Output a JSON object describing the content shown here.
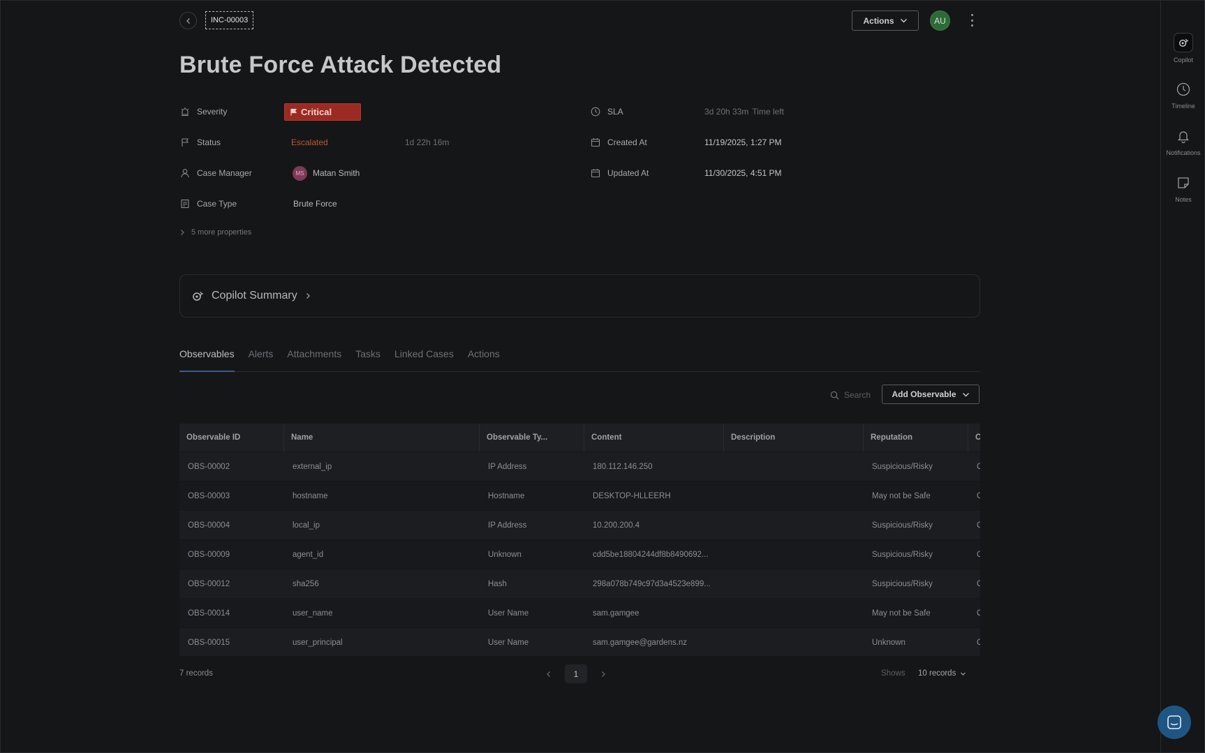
{
  "header": {
    "case_id": "INC-00003",
    "actions_label": "Actions",
    "user_initials": "AU"
  },
  "title": "Brute Force Attack Detected",
  "properties": {
    "severity_label": "Severity",
    "severity_value": "Critical",
    "status_label": "Status",
    "status_value": "Escalated",
    "status_duration": "1d 22h 16m",
    "manager_label": "Case Manager",
    "manager_initials": "MS",
    "manager_name": "Matan Smith",
    "type_label": "Case Type",
    "type_value": "Brute Force",
    "sla_label": "SLA",
    "sla_value": "3d 20h 33m",
    "sla_suffix": "Time left",
    "created_label": "Created At",
    "created_value": "11/19/2025, 1:27 PM",
    "updated_label": "Updated At",
    "updated_value": "11/30/2025, 4:51 PM",
    "more_label": "5 more properties"
  },
  "copilot_summary": "Copilot Summary",
  "tabs": [
    "Observables",
    "Alerts",
    "Attachments",
    "Tasks",
    "Linked Cases",
    "Actions"
  ],
  "toolbar": {
    "search_placeholder": "Search",
    "add_label": "Add Observable"
  },
  "table": {
    "headers": [
      "Observable ID",
      "Name",
      "Observable Ty...",
      "Content",
      "Description",
      "Reputation",
      "C"
    ],
    "rows": [
      [
        "OBS-00002",
        "external_ip",
        "IP Address",
        "180.112.146.250",
        "",
        "Suspicious/Risky",
        "C"
      ],
      [
        "OBS-00003",
        "hostname",
        "Hostname",
        "DESKTOP-HLLEERH",
        "",
        "May not be Safe",
        "C"
      ],
      [
        "OBS-00004",
        "local_ip",
        "IP Address",
        "10.200.200.4",
        "",
        "Suspicious/Risky",
        "C"
      ],
      [
        "OBS-00009",
        "agent_id",
        "Unknown",
        "cdd5be18804244df8b8490692...",
        "",
        "Suspicious/Risky",
        "C"
      ],
      [
        "OBS-00012",
        "sha256",
        "Hash",
        "298a078b749c97d3a4523e899...",
        "",
        "Suspicious/Risky",
        "C"
      ],
      [
        "OBS-00014",
        "user_name",
        "User Name",
        "sam.gamgee",
        "",
        "May not be Safe",
        "C"
      ],
      [
        "OBS-00015",
        "user_principal",
        "User Name",
        "sam.gamgee@gardens.nz",
        "",
        "Unknown",
        "C"
      ]
    ]
  },
  "footer": {
    "records": "7 records",
    "page": "1",
    "shows_label": "Shows",
    "per_page": "10 records"
  },
  "rightbar": {
    "copilot": "Copilot",
    "timeline": "Timeline",
    "notifications": "Notifications",
    "notes": "Notes"
  },
  "colors": {
    "critical": "#9b2a22",
    "escalated": "#c0582e",
    "accent_tab": "#3e5d86",
    "chat_fab": "#1f5582"
  }
}
